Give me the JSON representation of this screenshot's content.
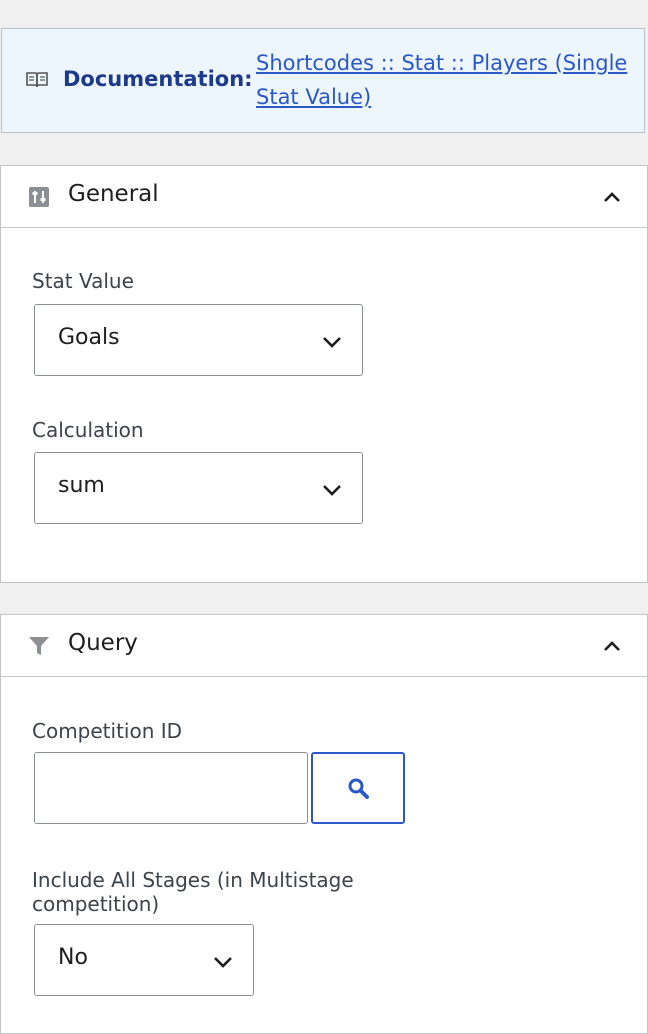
{
  "documentation": {
    "label": "Documentation:",
    "link_text": "Shortcodes :: Stat :: Players (Single Stat Value)"
  },
  "general": {
    "title": "General",
    "stat_value": {
      "label": "Stat Value",
      "selected": "Goals"
    },
    "calculation": {
      "label": "Calculation",
      "selected": "sum"
    }
  },
  "query": {
    "title": "Query",
    "competition_id": {
      "label": "Competition ID",
      "value": ""
    },
    "include_all_stages": {
      "label": "Include All Stages (in Multistage competition)",
      "selected": "No"
    }
  },
  "colors": {
    "accent": "#2a58c7",
    "doc_background": "#eef6fd",
    "doc_label": "#1d3a8a",
    "page_background": "#f0f0f1",
    "border": "#c3c4c7"
  },
  "icons": {
    "documentation": "book-icon",
    "general": "sliders-icon",
    "query": "filter-icon",
    "collapse": "chevron-up-icon",
    "select": "chevron-down-icon",
    "search": "search-icon"
  }
}
